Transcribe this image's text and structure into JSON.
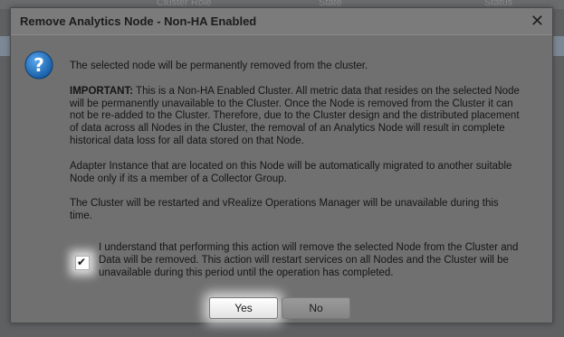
{
  "background": {
    "columns": [
      "Cluster Role",
      "State",
      "Status"
    ]
  },
  "dialog": {
    "title": "Remove Analytics Node - Non-HA Enabled",
    "close_glyph": "✕",
    "icon": "help-question-icon",
    "message_intro": "The selected node will be permanently removed from the cluster.",
    "important_label": "IMPORTANT:",
    "important_text": " This is a Non-HA Enabled Cluster. All metric data that resides on the selected Node will be permanently unavailable to the Cluster. Once the Node is removed from the Cluster it can not be re-added to the Cluster. Therefore, due to the Cluster design and the distributed placement of data across all Nodes in the Cluster, the removal of an Analytics Node will result in complete historical data loss for all data stored on that Node.",
    "adapter_text": "Adapter Instance that are located on this Node will be automatically migrated to another suitable Node only if its a member of a Collector Group.",
    "restart_text": "The Cluster will be restarted and vRealize Operations Manager will be unavailable during this time.",
    "acknowledge_text": "I understand that performing this action will remove the selected Node from the Cluster and Data will be removed. This action will restart services on all Nodes and the Cluster will be unavailable during this period until the operation has completed.",
    "acknowledge_checked": true,
    "yes_label": "Yes",
    "no_label": "No"
  },
  "colors": {
    "overlay": "#5f6062",
    "dialog_bg": "#707070",
    "titlebar_bg": "#7b7b7b",
    "icon_blue": "#1a6fc2"
  }
}
